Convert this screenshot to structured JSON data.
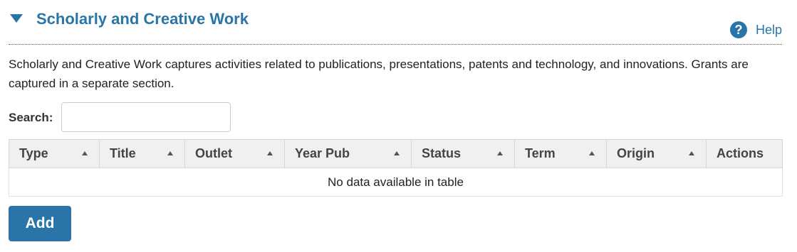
{
  "section": {
    "title": "Scholarly and Creative Work",
    "help_label": "Help",
    "help_icon_glyph": "?",
    "description": "Scholarly and Creative Work captures activities related to publications, presentations, patents and technology, and innovations. Grants are captured in a separate section."
  },
  "search": {
    "label": "Search:",
    "value": "",
    "placeholder": ""
  },
  "table": {
    "columns": [
      {
        "label": "Type",
        "sortable": true
      },
      {
        "label": "Title",
        "sortable": true
      },
      {
        "label": "Outlet",
        "sortable": true
      },
      {
        "label": "Year Pub",
        "sortable": true
      },
      {
        "label": "Status",
        "sortable": true
      },
      {
        "label": "Term",
        "sortable": true
      },
      {
        "label": "Origin",
        "sortable": true
      },
      {
        "label": "Actions",
        "sortable": false
      }
    ],
    "empty_message": "No data available in table"
  },
  "actions": {
    "add_label": "Add"
  },
  "colors": {
    "accent": "#2a75a8"
  },
  "icons": {
    "toggle": "triangle-down-icon",
    "help": "question-circle-icon",
    "sort": "sort-up-icon"
  }
}
